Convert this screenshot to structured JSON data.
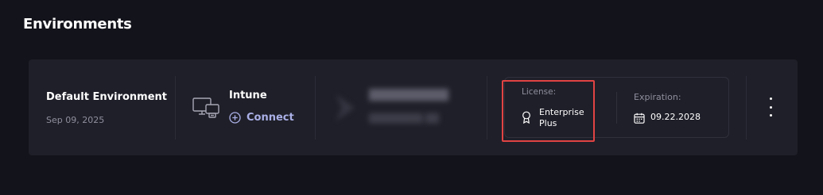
{
  "page": {
    "title": "Environments"
  },
  "environment": {
    "name": "Default Environment",
    "created_date": "Sep 09, 2025",
    "integration": {
      "name": "Intune",
      "action_label": "Connect",
      "icon": "devices-icon"
    },
    "license": {
      "label": "License:",
      "value": "Enterprise Plus",
      "icon": "award-ribbon-icon"
    },
    "expiration": {
      "label": "Expiration:",
      "value": "09.22.2028",
      "icon": "calendar-icon"
    },
    "menu_icon": "more-vertical-icon"
  },
  "colors": {
    "background": "#13131b",
    "card": "#1f1f29",
    "accent_link": "#aab0e6",
    "highlight": "#e14343",
    "muted_text": "#8f8f9e"
  }
}
